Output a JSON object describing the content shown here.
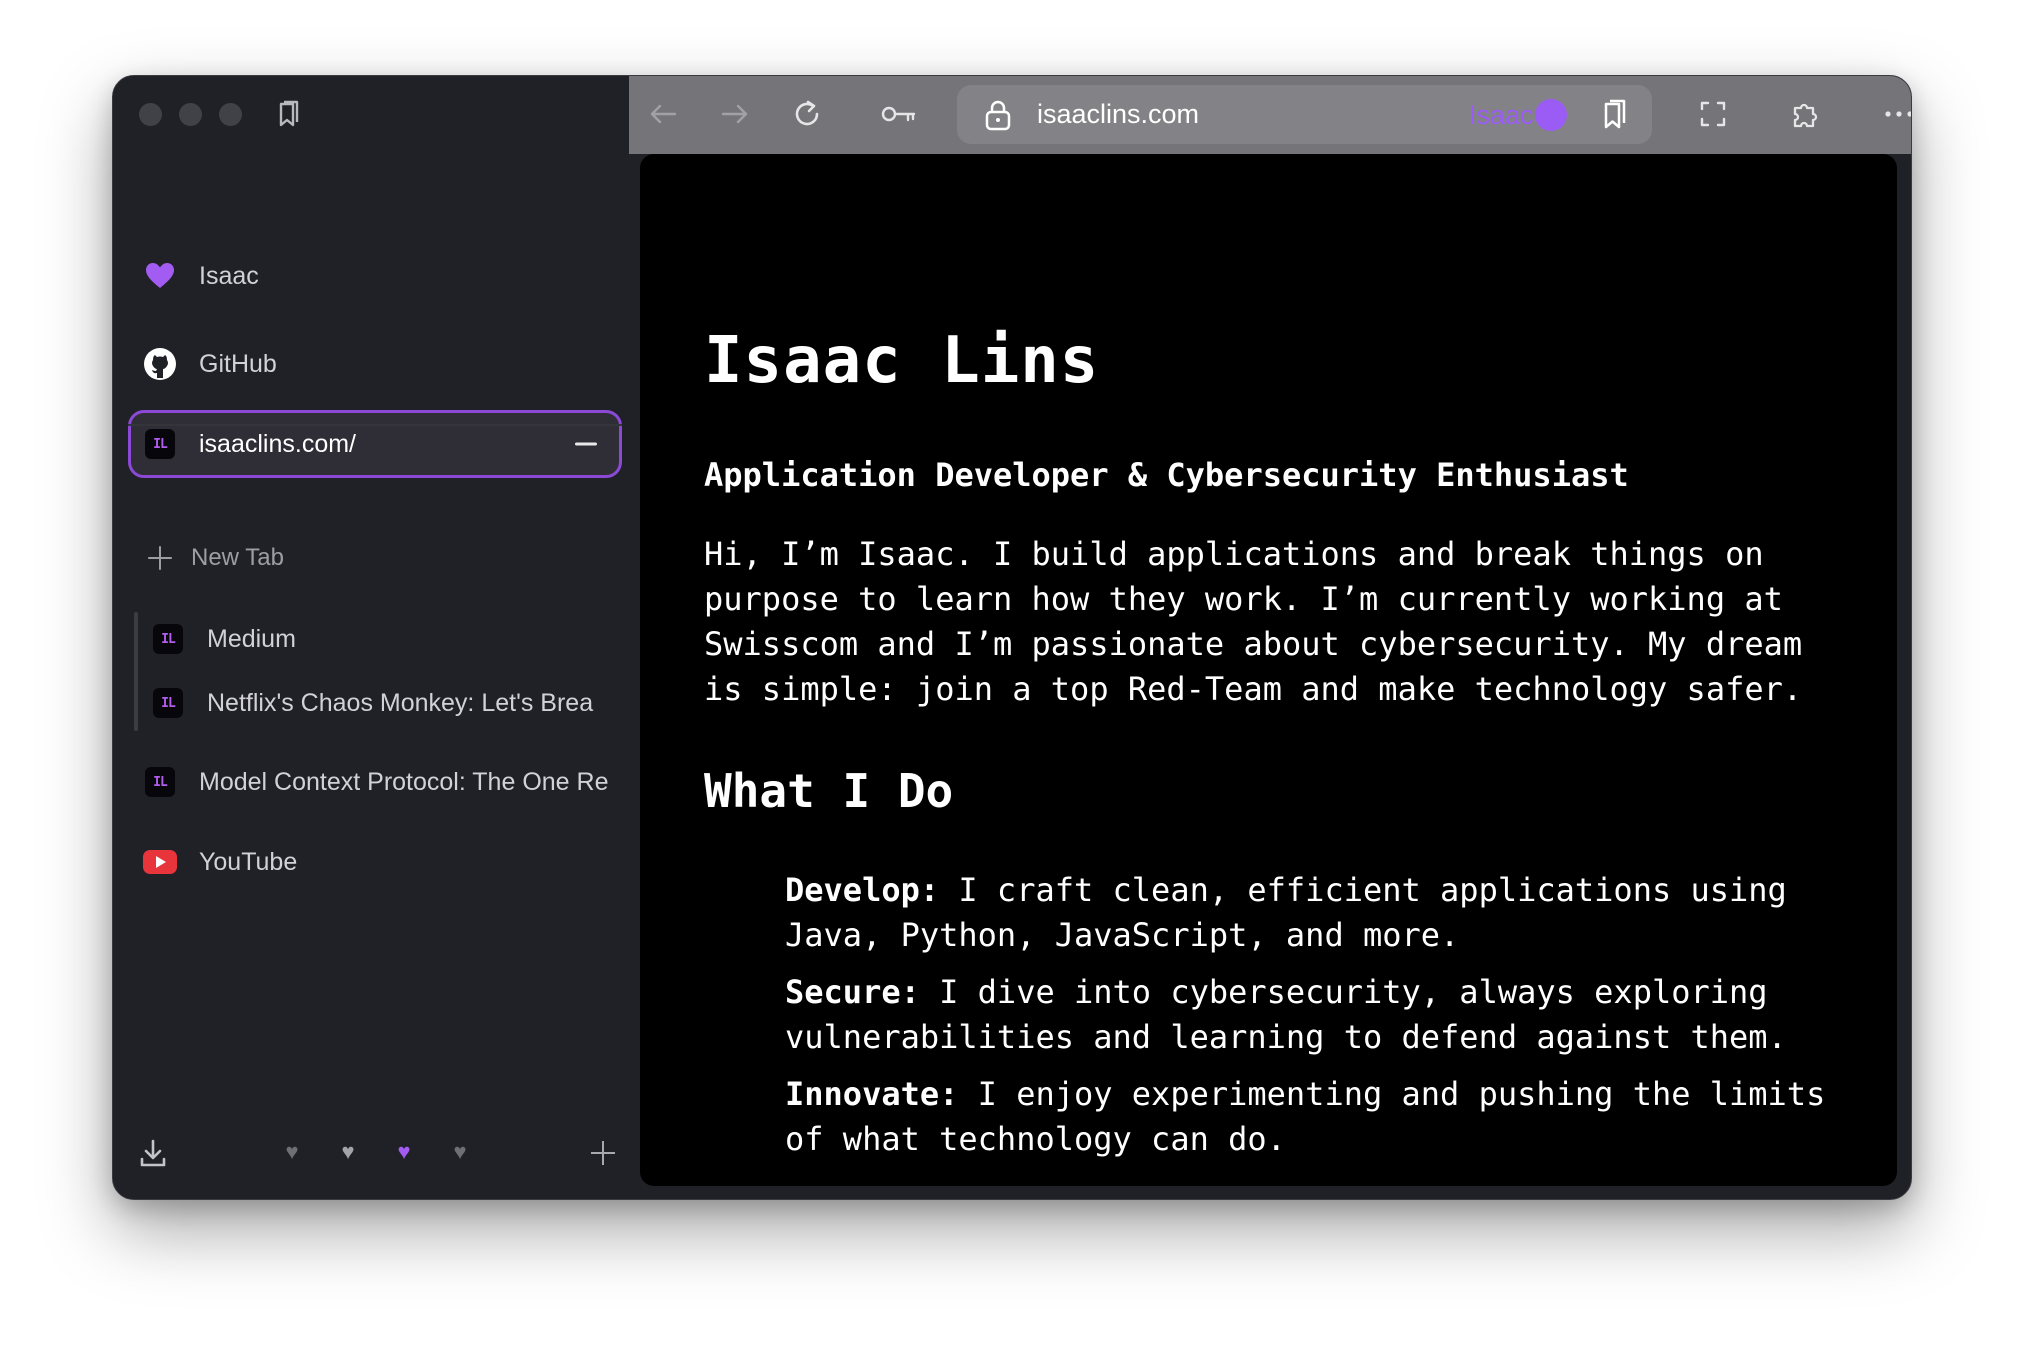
{
  "sidebar": {
    "pinned": [
      {
        "label": "Isaac",
        "icon": "purple-heart-icon"
      },
      {
        "label": "GitHub",
        "icon": "github-icon"
      },
      {
        "label": "isaaclins.com/",
        "icon": "il-badge-icon",
        "badge": "IL"
      }
    ],
    "new_tab_label": "New Tab",
    "group_tabs": [
      {
        "label": "Medium",
        "badge": "IL"
      },
      {
        "label": "Netflix's Chaos Monkey: Let's Brea",
        "badge": "IL"
      }
    ],
    "tabs": [
      {
        "label": "Model Context Protocol: The One Re",
        "badge": "IL"
      },
      {
        "label": "YouTube",
        "icon": "youtube-icon"
      }
    ],
    "spaces": [
      {
        "icon": "grey-heart-icon",
        "glyph": "♥",
        "color": "#6e6e74"
      },
      {
        "icon": "grey-heart-icon",
        "glyph": "♥",
        "color": "#a3a3a8"
      },
      {
        "icon": "purple-heart-icon",
        "glyph": "♥",
        "color": "#a35cf2"
      },
      {
        "icon": "broken-heart-icon",
        "glyph": "♥",
        "color": "#6e6e74"
      }
    ]
  },
  "toolbar": {
    "url": "isaaclins.com",
    "profile_name": "Isaac",
    "accent": "#9b5cf5"
  },
  "page": {
    "title": "Isaac Lins",
    "subtitle": "Application Developer & Cybersecurity Enthusiast",
    "intro": "Hi, I’m Isaac. I build applications and break things on purpose to learn how they work. I’m currently working at Swisscom and I’m passionate about cybersecurity. My dream is simple: join a top Red-Team and make technology safer.",
    "section_title": "What I Do",
    "items": [
      {
        "term": "Develop:",
        "text": " I craft clean, efficient applications using Java, Python, JavaScript, and more."
      },
      {
        "term": "Secure:",
        "text": " I dive into cybersecurity, always exploring vulnerabilities and learning to defend against them."
      },
      {
        "term": "Innovate:",
        "text": " I enjoy experimenting and pushing the limits of what technology can do."
      }
    ]
  }
}
